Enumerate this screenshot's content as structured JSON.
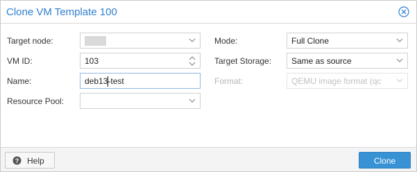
{
  "dialog": {
    "title": "Clone VM Template 100",
    "close_icon": "close-circle-icon"
  },
  "form": {
    "target_node": {
      "label": "Target node:",
      "value": ""
    },
    "vm_id": {
      "label": "VM ID:",
      "value": "103"
    },
    "name": {
      "label": "Name:",
      "value": "deb13-test",
      "caret_after": "deb13"
    },
    "resource_pool": {
      "label": "Resource Pool:",
      "value": ""
    },
    "mode": {
      "label": "Mode:",
      "value": "Full Clone"
    },
    "target_storage": {
      "label": "Target Storage:",
      "value": "Same as source"
    },
    "format": {
      "label": "Format:",
      "value": "QEMU image format (qc"
    }
  },
  "footer": {
    "help_label": "Help",
    "clone_label": "Clone"
  },
  "colors": {
    "title": "#2f7fd0",
    "primary_button": "#3892d4",
    "footer_bg": "#f4f4f4"
  }
}
